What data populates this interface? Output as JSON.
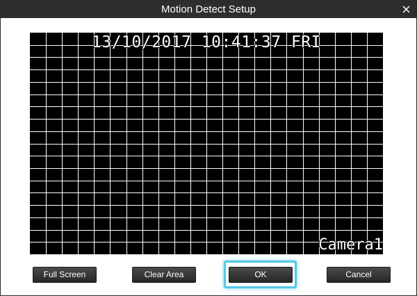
{
  "window": {
    "title": "Motion Detect Setup"
  },
  "preview": {
    "timestamp": "13/10/2017 10:41:37 FRI",
    "camera_label": "Camera1",
    "grid": {
      "columns": 22,
      "rows": 18
    }
  },
  "buttons": {
    "full_screen": "Full Screen",
    "clear_area": "Clear Area",
    "ok": "OK",
    "cancel": "Cancel"
  },
  "colors": {
    "titlebar": "#2d2d2d",
    "focus_ring": "#55c8e6",
    "grid_line": "#ffffff"
  },
  "icons": {
    "close": "close-icon"
  }
}
